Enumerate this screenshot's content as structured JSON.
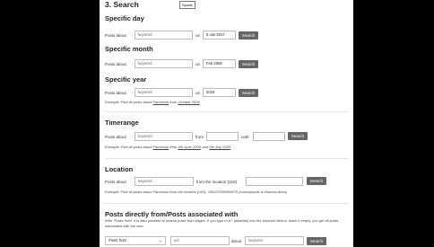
{
  "section_title": "3. Search",
  "tooltip": "Sports",
  "specific_day": {
    "title": "Specific day",
    "posts_about": "Posts about",
    "keyword_placeholder": "keyword",
    "on": "on",
    "date_value": "9 Jan 2017",
    "search": "Search"
  },
  "specific_month": {
    "title": "Specific month",
    "posts_about": "Posts about",
    "keyword_placeholder": "keyword",
    "on": "on",
    "date_value": "Feb 2008",
    "search": "Search"
  },
  "specific_year": {
    "title": "Specific year",
    "posts_about": "Posts about",
    "keyword_placeholder": "keyword",
    "on": "on",
    "date_value": "2018",
    "search": "Search",
    "example_prefix": "Example: Find all posts about",
    "example_link1": "Facebook",
    "example_mid": "from",
    "example_link2": "October 2005"
  },
  "timerange": {
    "title": "Timerange",
    "posts_about": "Posts about",
    "keyword_placeholder": "keyword",
    "from": "from",
    "until": "until",
    "search": "Search",
    "example_prefix": "Example: Find all posts about",
    "example_link1": "Facebook",
    "example_mid1": "from",
    "example_link2": "4th June 2005",
    "example_mid2": "until",
    "example_link3": "9th July 2005"
  },
  "location": {
    "title": "Location",
    "posts_about": "Posts about",
    "keyword_placeholder": "keyword",
    "from_location": "from the location (UID)",
    "search": "Search",
    "example": "Example: Find all posts about Facebook from the location (UID): 106423786059675 (corresponds to Buenos Aires)"
  },
  "posts_directly": {
    "title": "Posts directly from/Posts associated with",
    "description": "With \"Posts from\" it is also possible to search posts from pages. If you type in a * (asterisk) into the keyword field or leave it empty, you get all posts associated with the user.",
    "select_value": "Posts from",
    "uid_placeholder": "uid",
    "about": "about",
    "keyword_placeholder": "keyword",
    "search": "Search"
  }
}
